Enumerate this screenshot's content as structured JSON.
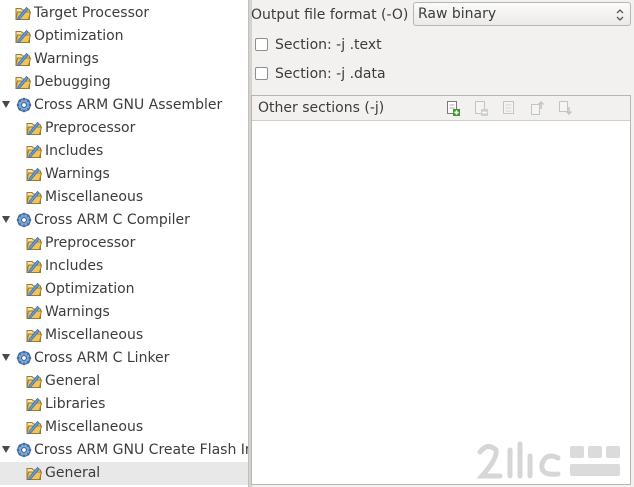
{
  "tree": {
    "items": [
      {
        "label": "Target Processor",
        "level": 1,
        "icon": "folder-options-icon"
      },
      {
        "label": "Optimization",
        "level": 1,
        "icon": "folder-options-icon"
      },
      {
        "label": "Warnings",
        "level": 1,
        "icon": "folder-options-icon"
      },
      {
        "label": "Debugging",
        "level": 1,
        "icon": "folder-options-icon"
      },
      {
        "label": "Cross ARM GNU Assembler",
        "level": 0,
        "icon": "tool-gear-icon",
        "expanded": true
      },
      {
        "label": "Preprocessor",
        "level": 2,
        "icon": "folder-options-icon"
      },
      {
        "label": "Includes",
        "level": 2,
        "icon": "folder-options-icon"
      },
      {
        "label": "Warnings",
        "level": 2,
        "icon": "folder-options-icon"
      },
      {
        "label": "Miscellaneous",
        "level": 2,
        "icon": "folder-options-icon"
      },
      {
        "label": "Cross ARM C Compiler",
        "level": 0,
        "icon": "tool-gear-icon",
        "expanded": true
      },
      {
        "label": "Preprocessor",
        "level": 2,
        "icon": "folder-options-icon"
      },
      {
        "label": "Includes",
        "level": 2,
        "icon": "folder-options-icon"
      },
      {
        "label": "Optimization",
        "level": 2,
        "icon": "folder-options-icon"
      },
      {
        "label": "Warnings",
        "level": 2,
        "icon": "folder-options-icon"
      },
      {
        "label": "Miscellaneous",
        "level": 2,
        "icon": "folder-options-icon"
      },
      {
        "label": "Cross ARM C Linker",
        "level": 0,
        "icon": "tool-gear-icon",
        "expanded": true
      },
      {
        "label": "General",
        "level": 2,
        "icon": "folder-options-icon"
      },
      {
        "label": "Libraries",
        "level": 2,
        "icon": "folder-options-icon"
      },
      {
        "label": "Miscellaneous",
        "level": 2,
        "icon": "folder-options-icon"
      },
      {
        "label": "Cross ARM GNU Create Flash Im",
        "level": 0,
        "icon": "tool-gear-icon",
        "expanded": true
      },
      {
        "label": "General",
        "level": 2,
        "icon": "folder-options-icon",
        "selected": true
      }
    ]
  },
  "panel": {
    "output_format_label": "Output file format (-O)",
    "output_format_value": "Raw binary",
    "section_text_label": "Section: -j .text",
    "section_text_checked": false,
    "section_data_label": "Section: -j .data",
    "section_data_checked": false,
    "other_sections_label": "Other sections (-j)",
    "toolbar_icons": [
      "add-icon",
      "delete-icon",
      "edit-icon",
      "move-up-icon",
      "move-down-icon"
    ]
  },
  "colors": {
    "tree_background": "#ffffff",
    "selection": "#e8e8e8",
    "window_background": "#f2f1f0",
    "folder": "#e8b04a",
    "add_green": "#3a9a2a"
  }
}
